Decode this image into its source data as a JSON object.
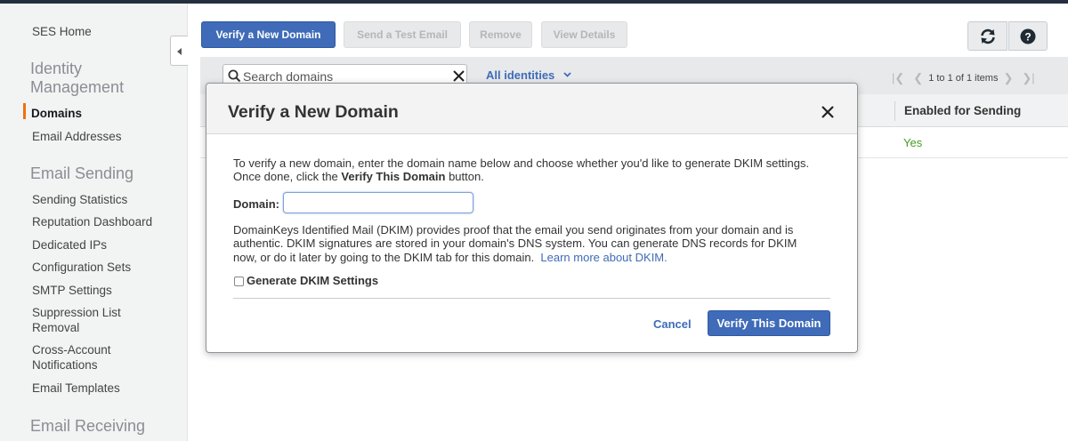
{
  "sidebar": {
    "home": "SES Home",
    "identity_heading": "Identity Management",
    "identity_items": [
      "Domains",
      "Email Addresses"
    ],
    "sending_heading": "Email Sending",
    "sending_items": [
      "Sending Statistics",
      "Reputation Dashboard",
      "Dedicated IPs",
      "Configuration Sets",
      "SMTP Settings",
      "Suppression List Removal",
      "Cross-Account Notifications",
      "Email Templates"
    ],
    "receiving_heading": "Email Receiving",
    "active_color": "#ec7211"
  },
  "toolbar": {
    "verify_domain": "Verify a New Domain",
    "send_test": "Send a Test Email",
    "remove": "Remove",
    "view_details": "View Details",
    "refresh_icon": "refresh-icon",
    "help_icon": "help-icon"
  },
  "filter": {
    "search_placeholder": "Search domains",
    "identity_filter": "All identities",
    "pager_text": "1 to 1 of 1 items"
  },
  "table": {
    "columns": [
      "Enabled for Sending"
    ],
    "rows": [
      [
        "Yes"
      ]
    ]
  },
  "modal": {
    "title": "Verify a New Domain",
    "intro_line1": "To verify a new domain, enter the domain name below and choose whether you'd like to generate DKIM settings.",
    "intro_line2_prefix": "Once done, click the ",
    "intro_line2_bold": "Verify This Domain",
    "intro_line2_suffix": " button.",
    "domain_label": "Domain:",
    "domain_value": "",
    "dkim_line1": "DomainKeys Identified Mail (DKIM) provides proof that the email you send originates from your domain and is",
    "dkim_line2": "authentic. DKIM signatures are stored in your domain's DNS system. You can generate DNS records for DKIM",
    "dkim_line3_prefix": "now, or do it later by going to the DKIM tab for this domain.  ",
    "dkim_link": "Learn more about DKIM.",
    "checkbox_label": "Generate DKIM Settings",
    "checkbox_checked": false,
    "cancel": "Cancel",
    "verify": "Verify This Domain",
    "accent_color": "#3f6bb8"
  }
}
